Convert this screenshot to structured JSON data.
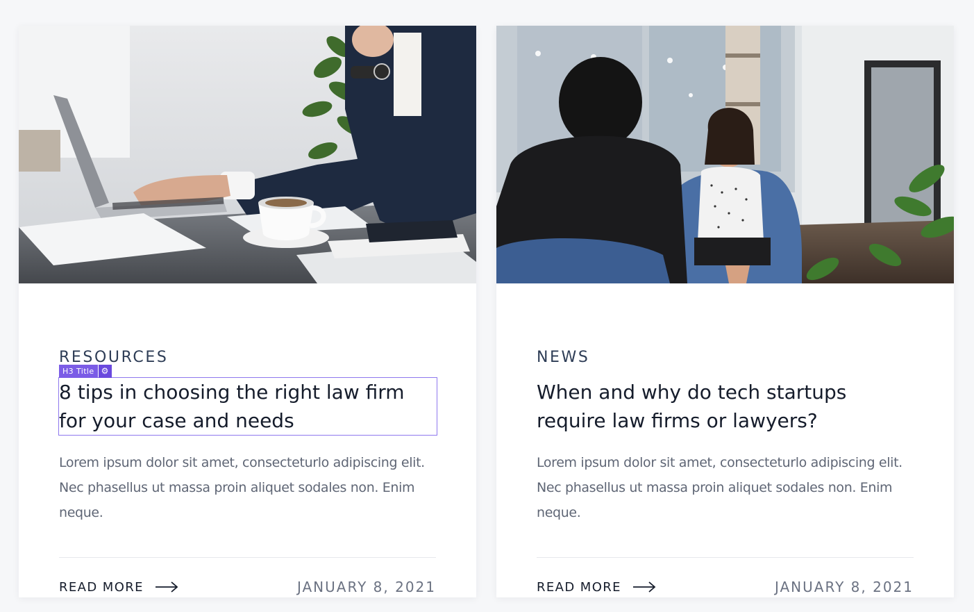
{
  "posts": [
    {
      "image_alt": "Man in a suit typing on a laptop at a desk with a coffee cup and notebooks",
      "category": "RESOURCES",
      "title": "8 tips in choosing the right law firm for your case and needs",
      "excerpt": "Lorem ipsum dolor sit amet, consecteturlo adipiscing elit. Nec phasellus ut massa proin aliquet sodales non. Enim neque.",
      "read_more": "READ MORE",
      "date": "JANUARY 8, 2021",
      "selected": true
    },
    {
      "image_alt": "Man in a dark suit talking with a woman seated in a blue armchair in an office",
      "category": "NEWS",
      "title": "When and why do tech startups require law firms or lawyers?",
      "excerpt": "Lorem ipsum dolor sit amet, consecteturlo adipiscing elit. Nec phasellus ut massa proin aliquet sodales non. Enim neque.",
      "read_more": "READ MORE",
      "date": "JANUARY 8, 2021",
      "selected": false
    }
  ],
  "editor_overlay": {
    "tag_label": "H3 Title",
    "gear_glyph": "⚙",
    "accent_color": "#7b5ce6"
  }
}
